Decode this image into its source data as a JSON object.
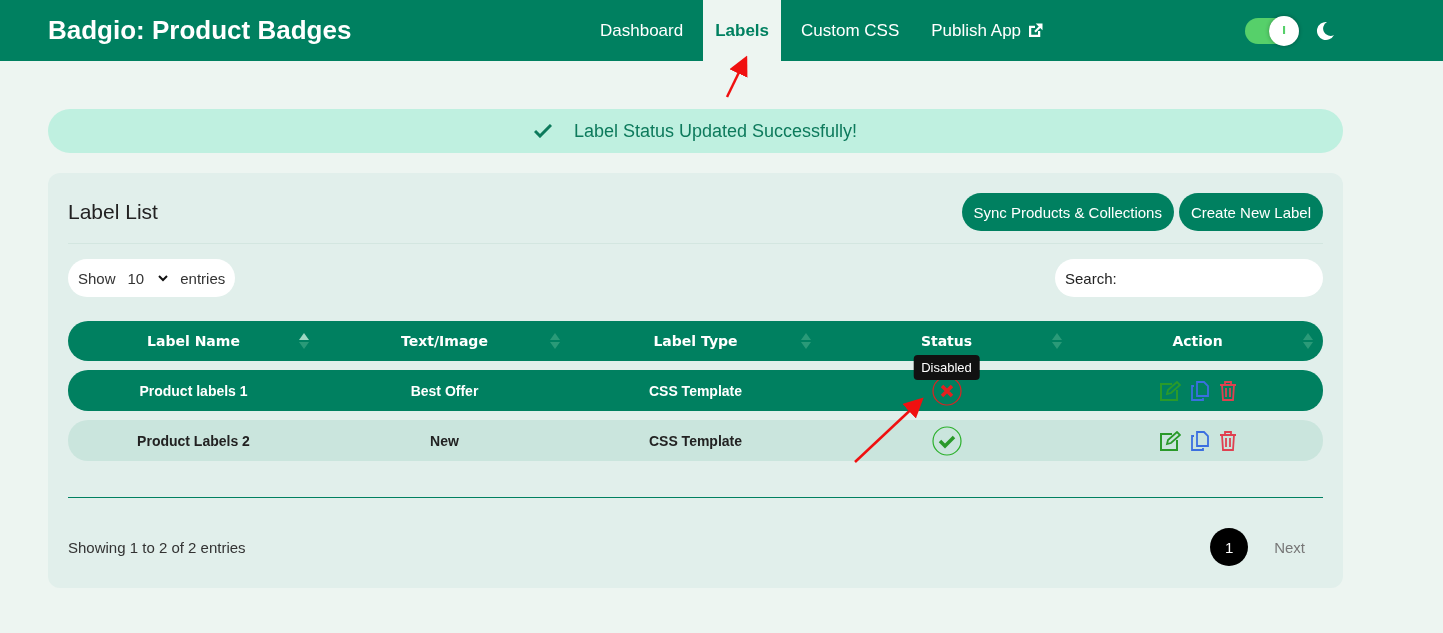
{
  "app_title": "Badgio: Product Badges",
  "nav": [
    {
      "label": "Dashboard",
      "selected": false,
      "external": false
    },
    {
      "label": "Labels",
      "selected": true,
      "external": false
    },
    {
      "label": "Custom CSS",
      "selected": false,
      "external": false
    },
    {
      "label": "Publish App",
      "selected": false,
      "external": true
    }
  ],
  "theme_toggle": {
    "on": true,
    "knob": "I"
  },
  "alert": {
    "message": "Label Status Updated Successfully!"
  },
  "card": {
    "title": "Label List",
    "buttons": [
      "Sync Products & Collections",
      "Create New Label"
    ]
  },
  "length": {
    "prefix": "Show",
    "value": "10",
    "suffix": "entries"
  },
  "search": {
    "label": "Search:"
  },
  "table": {
    "columns": [
      {
        "label": "Label Name",
        "sorted": true
      },
      {
        "label": "Text/Image",
        "sorted": false
      },
      {
        "label": "Label Type",
        "sorted": false
      },
      {
        "label": "Status",
        "sorted": false
      },
      {
        "label": "Action",
        "sorted": false
      }
    ],
    "rows": [
      {
        "name": "Product labels 1",
        "text": "Best Offer",
        "type": "CSS Template",
        "enabled": false,
        "selected": true,
        "tooltip": "Disabled"
      },
      {
        "name": "Product Labels 2",
        "text": "New",
        "type": "CSS Template",
        "enabled": true,
        "selected": false
      }
    ]
  },
  "info": "Showing 1 to 2 of 2 entries",
  "pagination": {
    "pages": [
      {
        "label": "1",
        "selected": true
      }
    ],
    "next": "Next"
  }
}
